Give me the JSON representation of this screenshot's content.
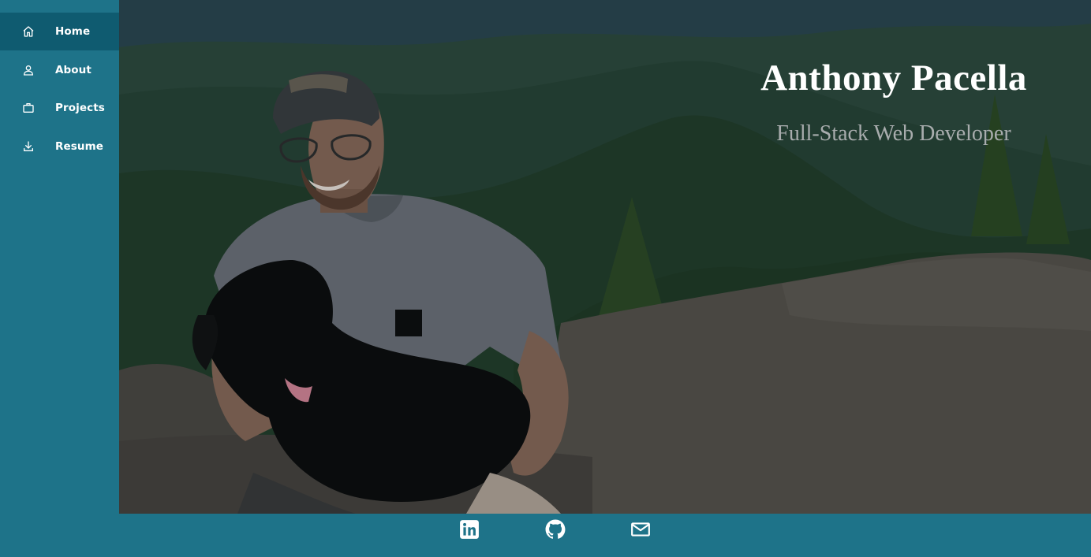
{
  "sidebar": {
    "items": [
      {
        "label": "Home",
        "icon": "home-icon",
        "active": true
      },
      {
        "label": "About",
        "icon": "user-icon",
        "active": false
      },
      {
        "label": "Projects",
        "icon": "briefcase-icon",
        "active": false
      },
      {
        "label": "Resume",
        "icon": "download-icon",
        "active": false
      }
    ]
  },
  "hero": {
    "name": "Anthony Pacella",
    "tagline": "Full-Stack Web Developer",
    "photo": "Man wearing a cap and glasses kneeling on a rock holding a black puppy, green mountain valley behind"
  },
  "footer": {
    "links": [
      {
        "icon": "linkedin-icon"
      },
      {
        "icon": "github-icon"
      },
      {
        "icon": "mail-icon"
      }
    ]
  },
  "colors": {
    "sidebar_bg": "#1e7389",
    "active_bg": "#0f5b70",
    "title": "#ffffff",
    "subtitle": "#a8acad"
  }
}
